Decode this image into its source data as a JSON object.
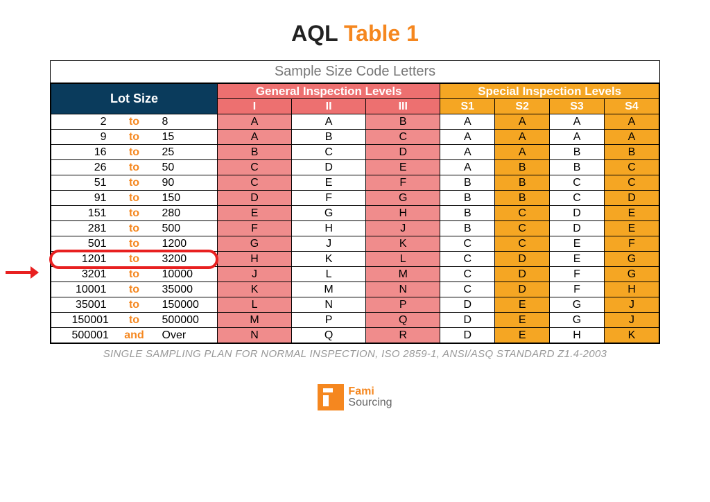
{
  "title_prefix": "AQL",
  "title_suffix": "Table 1",
  "table_header": "Sample Size Code Letters",
  "lot_size_label": "Lot Size",
  "general_label": "General Inspection Levels",
  "special_label": "Special Inspection Levels",
  "gen_cols": [
    "I",
    "II",
    "III"
  ],
  "spec_cols": [
    "S1",
    "S2",
    "S3",
    "S4"
  ],
  "to_word": "to",
  "and_word": "and",
  "over_word": "Over",
  "rows": [
    {
      "min": "2",
      "max": "8",
      "g": [
        "A",
        "A",
        "B"
      ],
      "s": [
        "A",
        "A",
        "A",
        "A"
      ]
    },
    {
      "min": "9",
      "max": "15",
      "g": [
        "A",
        "B",
        "C"
      ],
      "s": [
        "A",
        "A",
        "A",
        "A"
      ]
    },
    {
      "min": "16",
      "max": "25",
      "g": [
        "B",
        "C",
        "D"
      ],
      "s": [
        "A",
        "A",
        "B",
        "B"
      ]
    },
    {
      "min": "26",
      "max": "50",
      "g": [
        "C",
        "D",
        "E"
      ],
      "s": [
        "A",
        "B",
        "B",
        "C"
      ]
    },
    {
      "min": "51",
      "max": "90",
      "g": [
        "C",
        "E",
        "F"
      ],
      "s": [
        "B",
        "B",
        "C",
        "C"
      ]
    },
    {
      "min": "91",
      "max": "150",
      "g": [
        "D",
        "F",
        "G"
      ],
      "s": [
        "B",
        "B",
        "C",
        "D"
      ]
    },
    {
      "min": "151",
      "max": "280",
      "g": [
        "E",
        "G",
        "H"
      ],
      "s": [
        "B",
        "C",
        "D",
        "E"
      ]
    },
    {
      "min": "281",
      "max": "500",
      "g": [
        "F",
        "H",
        "J"
      ],
      "s": [
        "B",
        "C",
        "D",
        "E"
      ]
    },
    {
      "min": "501",
      "max": "1200",
      "g": [
        "G",
        "J",
        "K"
      ],
      "s": [
        "C",
        "C",
        "E",
        "F"
      ]
    },
    {
      "min": "1201",
      "max": "3200",
      "g": [
        "H",
        "K",
        "L"
      ],
      "s": [
        "C",
        "D",
        "E",
        "G"
      ],
      "highlight": true
    },
    {
      "min": "3201",
      "max": "10000",
      "g": [
        "J",
        "L",
        "M"
      ],
      "s": [
        "C",
        "D",
        "F",
        "G"
      ]
    },
    {
      "min": "10001",
      "max": "35000",
      "g": [
        "K",
        "M",
        "N"
      ],
      "s": [
        "C",
        "D",
        "F",
        "H"
      ]
    },
    {
      "min": "35001",
      "max": "150000",
      "g": [
        "L",
        "N",
        "P"
      ],
      "s": [
        "D",
        "E",
        "G",
        "J"
      ]
    },
    {
      "min": "150001",
      "max": "500000",
      "g": [
        "M",
        "P",
        "Q"
      ],
      "s": [
        "D",
        "E",
        "G",
        "J"
      ]
    },
    {
      "min": "500001",
      "max": "Over",
      "sep": "and",
      "g": [
        "N",
        "Q",
        "R"
      ],
      "s": [
        "D",
        "E",
        "H",
        "K"
      ]
    }
  ],
  "footnote": "SINGLE SAMPLING PLAN FOR NORMAL INSPECTION, ISO 2859-1, ANSI/ASQ STANDARD Z1.4-2003",
  "logo": {
    "line1": "Fami",
    "line2": "Sourcing"
  },
  "chart_data": {
    "type": "table",
    "title": "AQL Table 1 — Sample Size Code Letters",
    "columns": [
      "Lot Size Min",
      "Lot Size Max",
      "I",
      "II",
      "III",
      "S1",
      "S2",
      "S3",
      "S4"
    ],
    "rows": [
      [
        "2",
        "8",
        "A",
        "A",
        "B",
        "A",
        "A",
        "A",
        "A"
      ],
      [
        "9",
        "15",
        "A",
        "B",
        "C",
        "A",
        "A",
        "A",
        "A"
      ],
      [
        "16",
        "25",
        "B",
        "C",
        "D",
        "A",
        "A",
        "B",
        "B"
      ],
      [
        "26",
        "50",
        "C",
        "D",
        "E",
        "A",
        "B",
        "B",
        "C"
      ],
      [
        "51",
        "90",
        "C",
        "E",
        "F",
        "B",
        "B",
        "C",
        "C"
      ],
      [
        "91",
        "150",
        "D",
        "F",
        "G",
        "B",
        "B",
        "C",
        "D"
      ],
      [
        "151",
        "280",
        "E",
        "G",
        "H",
        "B",
        "C",
        "D",
        "E"
      ],
      [
        "281",
        "500",
        "F",
        "H",
        "J",
        "B",
        "C",
        "D",
        "E"
      ],
      [
        "501",
        "1200",
        "G",
        "J",
        "K",
        "C",
        "C",
        "E",
        "F"
      ],
      [
        "1201",
        "3200",
        "H",
        "K",
        "L",
        "C",
        "D",
        "E",
        "G"
      ],
      [
        "3201",
        "10000",
        "J",
        "L",
        "M",
        "C",
        "D",
        "F",
        "G"
      ],
      [
        "10001",
        "35000",
        "K",
        "M",
        "N",
        "C",
        "D",
        "F",
        "H"
      ],
      [
        "35001",
        "150000",
        "L",
        "N",
        "P",
        "D",
        "E",
        "G",
        "J"
      ],
      [
        "150001",
        "500000",
        "M",
        "P",
        "Q",
        "D",
        "E",
        "G",
        "J"
      ],
      [
        "500001",
        "Over",
        "N",
        "Q",
        "R",
        "D",
        "E",
        "H",
        "K"
      ]
    ],
    "highlighted_row_index": 9
  }
}
